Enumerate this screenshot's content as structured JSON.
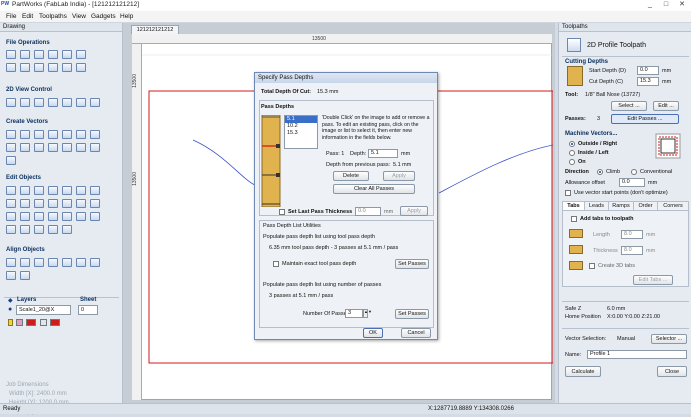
{
  "window": {
    "app_icon": "PW",
    "title": "PartWorks (FabLab India) - [121212121212]",
    "min": "_",
    "max": "□",
    "close": "✕"
  },
  "menu": [
    "File",
    "Edit",
    "Toolpaths",
    "View",
    "Gadgets",
    "Help"
  ],
  "left_panel": {
    "title": "Drawing",
    "sections": [
      "File Operations",
      "2D View Control",
      "Create Vectors",
      "Edit Objects",
      "Align Objects"
    ],
    "layers_label": "Layers",
    "sheet_label": "Sheet",
    "layer_value": "Scale1_20@X",
    "sheet_value": "0",
    "job_dims_title": "Job Dimensions",
    "job_width": "Width  [X]: 2400.0 mm",
    "job_height": "Height [Y]: 1200.0 mm",
    "job_depth": "Depth  [Z]: 15.0 mm"
  },
  "doc_tab": "121212121212",
  "rulers": {
    "h_mark": "13500",
    "v_mark1": "13500",
    "v_mark2": "13500"
  },
  "dialog": {
    "title": "Specify Pass Depths",
    "total_depth_label": "Total Depth Of Cut:",
    "total_depth_value": "15.3 mm",
    "pass_depths_title": "Pass Depths",
    "pass_list": [
      "5.1",
      "10.2",
      "15.3"
    ],
    "instructions": "'Double Click' on the image to add or remove a pass. To edit an existing pass, click on the image or list to select it, then enter new information in the fields below.",
    "pass_label": "Pass: 1",
    "depth_label": "Depth:",
    "depth_value": "5.1",
    "depth_unit": "mm",
    "depth_prev_label": "Depth from previous pass:",
    "depth_prev_value": "5.1 mm",
    "delete_btn": "Delete",
    "apply_btn": "Apply",
    "clear_btn": "Clear All Passes",
    "last_pass_label": "Set Last Pass Thickness",
    "last_pass_value": "0.0",
    "last_pass_unit": "mm",
    "last_apply_btn": "Apply",
    "utilities_title": "Pass Depth List Utilities",
    "util_line1": "Populate pass depth list using tool pass depth",
    "util_line2": "6.35 mm tool pass depth - 3 passes at 5.1 mm / pass",
    "maintain_label": "Maintain exact tool pass depth",
    "set_passes_btn1": "Set Passes",
    "util_line3": "Populate pass depth list using number of passes",
    "util_line4": "3 passes at 5.1 mm / pass",
    "num_passes_label": "Number Of Passes:",
    "num_passes_value": "3",
    "set_passes_btn2": "Set Passes",
    "ok_btn": "OK",
    "cancel_btn": "Cancel"
  },
  "right_panel": {
    "title": "Toolpaths",
    "toolpath_title": "2D Profile Toolpath",
    "cutting_depths": "Cutting Depths",
    "start_depth_label": "Start Depth (D)",
    "start_depth_value": "0.0",
    "cut_depth_label": "Cut Depth (C)",
    "cut_depth_value": "15.3",
    "mm": "mm",
    "tool_label": "Tool:",
    "tool_value": "1/8\" Ball Nose (13727)",
    "select_btn": "Select ...",
    "edit_btn": "Edit ...",
    "passes_label": "Passes:",
    "passes_value": "3",
    "edit_passes_btn": "Edit Passes ...",
    "machine_vectors": "Machine Vectors...",
    "outside": "Outside / Right",
    "inside": "Inside / Left",
    "on": "On",
    "direction_label": "Direction",
    "climb": "Climb",
    "conventional": "Conventional",
    "allowance_label": "Allowance offset",
    "allowance_value": "0.0",
    "allowance_unit": "mm",
    "vector_start": "Use vector start points (don't optimize)",
    "tabs": [
      "Tabs",
      "Leads",
      "Ramps",
      "Order",
      "Corners"
    ],
    "add_tabs": "Add tabs to toolpath",
    "length_label": "Length",
    "length_value": "8.0",
    "thickness_label": "Thickness",
    "thickness_value": "8.0",
    "create3d": "Create 3D tabs",
    "edit_tabs_btn": "Edit Tabs ...",
    "safe_z_label": "Safe Z",
    "safe_z_value": "6.0 mm",
    "home_label": "Home Position",
    "home_value": "X:0.00 Y:0.00 Z:21.00",
    "vector_sel_label": "Vector Selection:",
    "vector_sel_value": "Manual",
    "selector_btn": "Selector ...",
    "name_label": "Name:",
    "name_value": "Profile 1",
    "calculate_btn": "Calculate",
    "close_btn": "Close"
  },
  "status": {
    "left": "Ready",
    "coords": "X:1287719.8889 Y:134308.0266"
  },
  "colors": {
    "accent": "#1a3f8c",
    "profile_line": "#3b4fc9",
    "boundary": "#d01818"
  }
}
